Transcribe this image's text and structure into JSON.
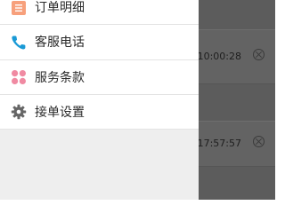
{
  "drawer": {
    "items": [
      {
        "label": "订单明细",
        "icon": "order-list-icon",
        "color": "#f7a07c"
      },
      {
        "label": "客服电话",
        "icon": "phone-icon",
        "color": "#1a9ad6"
      },
      {
        "label": "服务条款",
        "icon": "flower-icon",
        "color": "#f08aa2"
      },
      {
        "label": "接单设置",
        "icon": "gear-icon",
        "color": "#666666"
      }
    ]
  },
  "background": {
    "rows": [
      {
        "time": "10:00:28"
      },
      {
        "time": "17:57:57"
      }
    ]
  }
}
